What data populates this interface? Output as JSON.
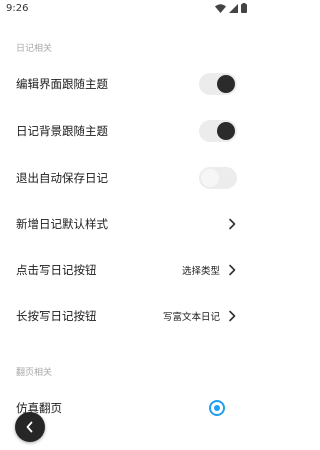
{
  "status_bar": {
    "time": "9:26"
  },
  "sections": [
    {
      "header": "日记相关",
      "rows": [
        {
          "label": "编辑界面跟随主题",
          "control": "toggle",
          "on": true
        },
        {
          "label": "日记背景跟随主题",
          "control": "toggle",
          "on": true
        },
        {
          "label": "退出自动保存日记",
          "control": "toggle",
          "on": false
        },
        {
          "label": "新增日记默认样式",
          "control": "chevron"
        },
        {
          "label": "点击写日记按钮",
          "control": "chevron",
          "value": "选择类型"
        },
        {
          "label": "长按写日记按钮",
          "control": "chevron",
          "value": "写富文本日记"
        }
      ]
    },
    {
      "header": "翻页相关",
      "rows": [
        {
          "label": "仿真翻页",
          "control": "radio",
          "selected": true
        }
      ]
    }
  ],
  "colors": {
    "accent": "#1ea1f2",
    "toggle_on_knob": "#2b2b2b",
    "toggle_track": "#ececec",
    "fab": "#262626"
  },
  "icons": {
    "back": "chevron-left-icon"
  }
}
